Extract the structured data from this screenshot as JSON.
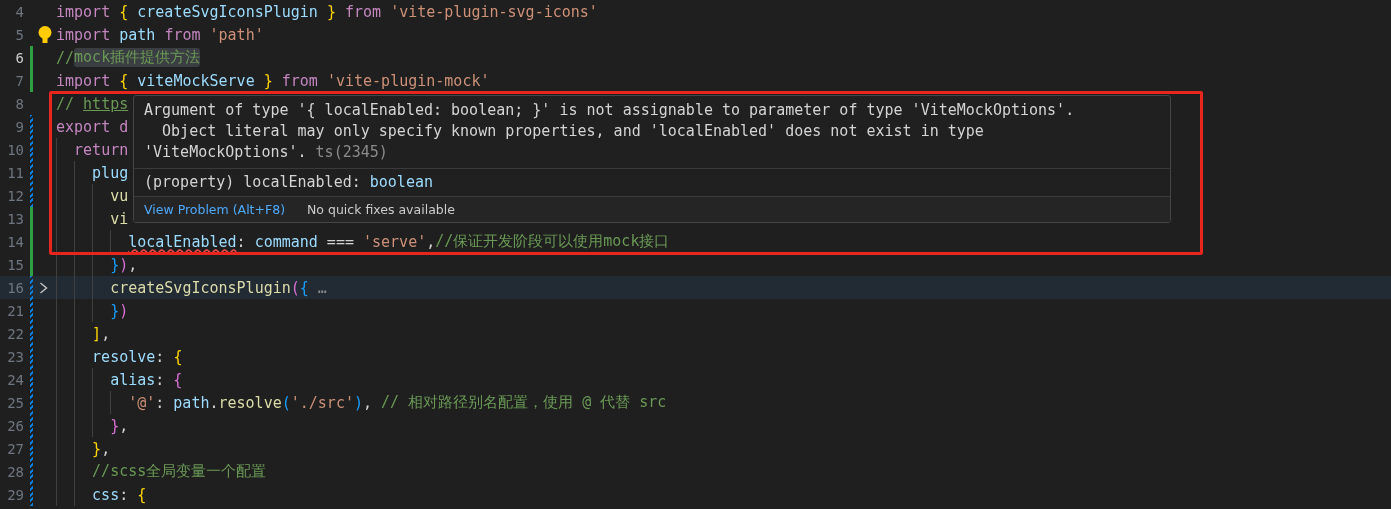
{
  "editor": {
    "lines": [
      {
        "number": "4",
        "tokens": [
          {
            "text": "import ",
            "kind": "kw"
          },
          {
            "text": "{",
            "kind": "b1"
          },
          {
            "text": " createSvgIconsPlugin ",
            "kind": "var"
          },
          {
            "text": "}",
            "kind": "b1"
          },
          {
            "text": " from ",
            "kind": "kw"
          },
          {
            "text": "'vite-plugin-svg-icons'",
            "kind": "str"
          }
        ]
      },
      {
        "number": "5",
        "lightbulb": true,
        "tokens": [
          {
            "text": "import",
            "kind": "kw"
          },
          {
            "text": " path ",
            "kind": "var"
          },
          {
            "text": "from ",
            "kind": "kw"
          },
          {
            "text": "'path'",
            "kind": "str"
          }
        ]
      },
      {
        "number": "6",
        "current": true,
        "added": true,
        "tokens": [
          {
            "text": "//",
            "kind": "com"
          },
          {
            "text": "mock插件提供方法",
            "kind": "com",
            "highlight": true
          }
        ]
      },
      {
        "number": "7",
        "added": true,
        "tokens": [
          {
            "text": "import ",
            "kind": "kw"
          },
          {
            "text": "{",
            "kind": "b1"
          },
          {
            "text": " viteMockServe ",
            "kind": "var"
          },
          {
            "text": "}",
            "kind": "b1"
          },
          {
            "text": " from ",
            "kind": "kw"
          },
          {
            "text": "'vite-plugin-mock'",
            "kind": "str"
          }
        ]
      },
      {
        "number": "8",
        "tokens": [
          {
            "text": "// ",
            "kind": "com"
          },
          {
            "text": "https",
            "kind": "link"
          }
        ]
      },
      {
        "number": "9",
        "modified": true,
        "tokens": [
          {
            "text": "export d",
            "kind": "kw"
          }
        ]
      },
      {
        "number": "10",
        "modified": true,
        "tokens": [
          {
            "text": "  return",
            "kind": "kw"
          }
        ]
      },
      {
        "number": "11",
        "modified": true,
        "tokens": [
          {
            "text": "    plug",
            "kind": "prop"
          }
        ]
      },
      {
        "number": "12",
        "modified": true,
        "tokens": [
          {
            "text": "      vu",
            "kind": "fn"
          }
        ]
      },
      {
        "number": "13",
        "added": true,
        "tokens": [
          {
            "text": "      vi",
            "kind": "fn"
          }
        ]
      },
      {
        "number": "14",
        "added": true,
        "tokens": [
          {
            "text": "        localEnabled",
            "kind": "prop",
            "error": true
          },
          {
            "text": ": ",
            "kind": "plain"
          },
          {
            "text": "command",
            "kind": "var"
          },
          {
            "text": " === ",
            "kind": "plain"
          },
          {
            "text": "'serve'",
            "kind": "str"
          },
          {
            "text": ",",
            "kind": "plain"
          },
          {
            "text": "//保证开发阶段可以使用mock接口",
            "kind": "com"
          }
        ]
      },
      {
        "number": "15",
        "added": true,
        "tokens": [
          {
            "text": "      }",
            "kind": "b3"
          },
          {
            "text": ")",
            "kind": "b2"
          },
          {
            "text": ",",
            "kind": "plain"
          }
        ]
      },
      {
        "number": "16",
        "modified": true,
        "folded": true,
        "tokens": [
          {
            "text": "      createSvgIconsPlugin",
            "kind": "fn"
          },
          {
            "text": "(",
            "kind": "b2"
          },
          {
            "text": "{",
            "kind": "b3"
          },
          {
            "text": " …",
            "kind": "fold"
          }
        ]
      },
      {
        "number": "21",
        "modified": true,
        "tokens": [
          {
            "text": "      }",
            "kind": "b3"
          },
          {
            "text": ")",
            "kind": "b2"
          }
        ]
      },
      {
        "number": "22",
        "modified": true,
        "tokens": [
          {
            "text": "    ]",
            "kind": "b1"
          },
          {
            "text": ",",
            "kind": "plain"
          }
        ]
      },
      {
        "number": "23",
        "modified": true,
        "tokens": [
          {
            "text": "    resolve",
            "kind": "prop"
          },
          {
            "text": ": ",
            "kind": "plain"
          },
          {
            "text": "{",
            "kind": "b1"
          }
        ]
      },
      {
        "number": "24",
        "modified": true,
        "tokens": [
          {
            "text": "      alias",
            "kind": "prop"
          },
          {
            "text": ": ",
            "kind": "plain"
          },
          {
            "text": "{",
            "kind": "b2"
          }
        ]
      },
      {
        "number": "25",
        "modified": true,
        "tokens": [
          {
            "text": "        '@'",
            "kind": "str"
          },
          {
            "text": ": ",
            "kind": "plain"
          },
          {
            "text": "path",
            "kind": "var"
          },
          {
            "text": ".",
            "kind": "plain"
          },
          {
            "text": "resolve",
            "kind": "fn"
          },
          {
            "text": "(",
            "kind": "b3"
          },
          {
            "text": "'./src'",
            "kind": "str"
          },
          {
            "text": ")",
            "kind": "b3"
          },
          {
            "text": ", ",
            "kind": "plain"
          },
          {
            "text": "// 相对路径别名配置，使用 @ 代替 src",
            "kind": "com"
          }
        ]
      },
      {
        "number": "26",
        "modified": true,
        "tokens": [
          {
            "text": "      }",
            "kind": "b2"
          },
          {
            "text": ",",
            "kind": "plain"
          }
        ]
      },
      {
        "number": "27",
        "modified": true,
        "tokens": [
          {
            "text": "    }",
            "kind": "b1"
          },
          {
            "text": ",",
            "kind": "plain"
          }
        ]
      },
      {
        "number": "28",
        "modified": true,
        "tokens": [
          {
            "text": "    //scss全局变量一个配置",
            "kind": "com"
          }
        ]
      },
      {
        "number": "29",
        "modified": true,
        "tokens": [
          {
            "text": "    css",
            "kind": "prop"
          },
          {
            "text": ": ",
            "kind": "plain"
          },
          {
            "text": "{",
            "kind": "b1"
          }
        ]
      }
    ]
  },
  "hover": {
    "message": "Argument of type '{ localEnabled: boolean; }' is not assignable to parameter of type 'ViteMockOptions'.\n  Object literal may only specify known properties, and 'localEnabled' does not exist in type\n'ViteMockOptions'.",
    "code": "ts(2345)",
    "signature": [
      {
        "text": "(property)",
        "kind": "kw2"
      },
      {
        "text": " localEnabled: ",
        "kind": "plain"
      },
      {
        "text": "boolean",
        "kind": "var"
      }
    ],
    "link": "View Problem (Alt+F8)",
    "status": "No quick fixes available"
  },
  "annotation": {
    "kind": "frame"
  }
}
